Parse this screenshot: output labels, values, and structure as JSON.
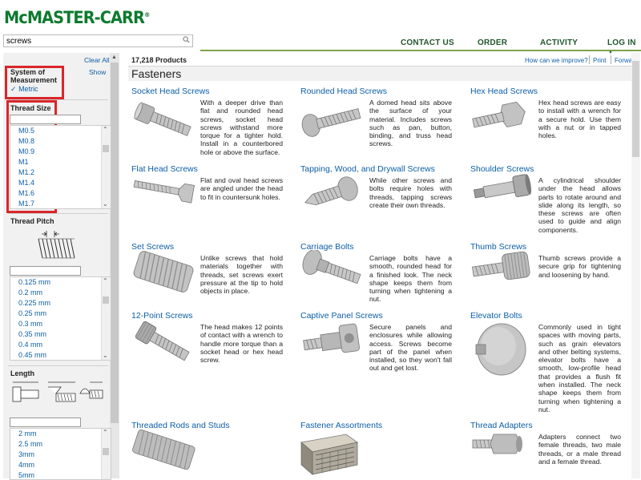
{
  "brand": {
    "logo_text": "McMASTER-CARR",
    "logo_mark": "®",
    "accent_color": "#0d7a2e",
    "link_color": "#0d5fa8"
  },
  "search": {
    "value": "screws",
    "icon": "search-icon"
  },
  "nav": {
    "contact": "CONTACT US",
    "order": "ORDER",
    "activity": "ACTIVITY",
    "login": "LOG IN",
    "login_icon": "caret-down-icon"
  },
  "sidebar": {
    "clear_all": "Clear All",
    "system": {
      "title_line1": "System of",
      "title_line2": "Measurement",
      "show": "Show",
      "selected": "Metric",
      "check": "✓"
    },
    "thread_size": {
      "title": "Thread Size",
      "items": [
        "M0.5",
        "M0.8",
        "M0.9",
        "M1",
        "M1.2",
        "M1.4",
        "M1.6",
        "M1.7"
      ]
    },
    "thread_pitch": {
      "title": "Thread Pitch",
      "items": [
        "0.125 mm",
        "0.2 mm",
        "0.225 mm",
        "0.25 mm",
        "0.3 mm",
        "0.35 mm",
        "0.4 mm",
        "0.45 mm"
      ]
    },
    "length": {
      "title": "Length",
      "items": [
        "2 mm",
        "2.5 mm",
        "3mm",
        "4mm",
        "5mm"
      ]
    }
  },
  "main": {
    "product_count": "17,218 Products",
    "links": {
      "improve": "How can we improve?",
      "print": "Print",
      "forward": "Forward"
    },
    "section_title": "Fasteners",
    "categories": [
      {
        "title": "Socket Head Screws",
        "desc": "With a deeper drive than flat and rounded head screws, socket head screws withstand more torque for a tighter hold. Install in a counterbored hole or above the surface."
      },
      {
        "title": "Rounded Head Screws",
        "desc": "A domed head sits above the surface of your material. Includes screws such as pan, button, binding, and truss head screws."
      },
      {
        "title": "Hex Head Screws",
        "desc": "Hex head screws are easy to install with a wrench for a secure hold. Use them with a nut or in tapped holes."
      },
      {
        "title": "Flat Head Screws",
        "desc": "Flat and oval head screws are angled under the head to fit in countersunk holes."
      },
      {
        "title": "Tapping, Wood, and Drywall Screws",
        "desc": "While other screws and bolts require holes with threads, tapping screws create their own threads."
      },
      {
        "title": "Shoulder Screws",
        "desc": "A cylindrical shoulder under the head allows parts to rotate around and slide along its length, so these screws are often used to guide and align components."
      },
      {
        "title": "Set Screws",
        "desc": "Unlike screws that hold materials together with threads, set screws exert pressure at the tip to hold objects in place."
      },
      {
        "title": "Carriage Bolts",
        "desc": "Carriage bolts have a smooth, rounded head for a finished look. The neck shape keeps them from turning when tightening a nut."
      },
      {
        "title": "Thumb Screws",
        "desc": "Thumb screws provide a secure grip for tightening and loosening by hand."
      },
      {
        "title": "12-Point Screws",
        "desc": "The head makes 12 points of contact with a wrench to handle more torque than a socket head or hex head screw."
      },
      {
        "title": "Captive Panel Screws",
        "desc": "Secure panels and enclosures while allowing access. Screws become part of the panel when installed, so they won't fall out and get lost."
      },
      {
        "title": "Elevator Bolts",
        "desc": "Commonly used in tight spaces with moving parts, such as grain elevators and other belting systems, elevator bolts have a smooth, low-profile head that provides a flush fit when installed. The neck shape keeps them from turning when tightening a nut."
      },
      {
        "title": "Threaded Rods and Studs",
        "desc": ""
      },
      {
        "title": "Fastener Assortments",
        "desc": ""
      },
      {
        "title": "Thread Adapters",
        "desc": "Adapters connect two female threads, two male threads, or a male thread and a female thread."
      }
    ]
  }
}
